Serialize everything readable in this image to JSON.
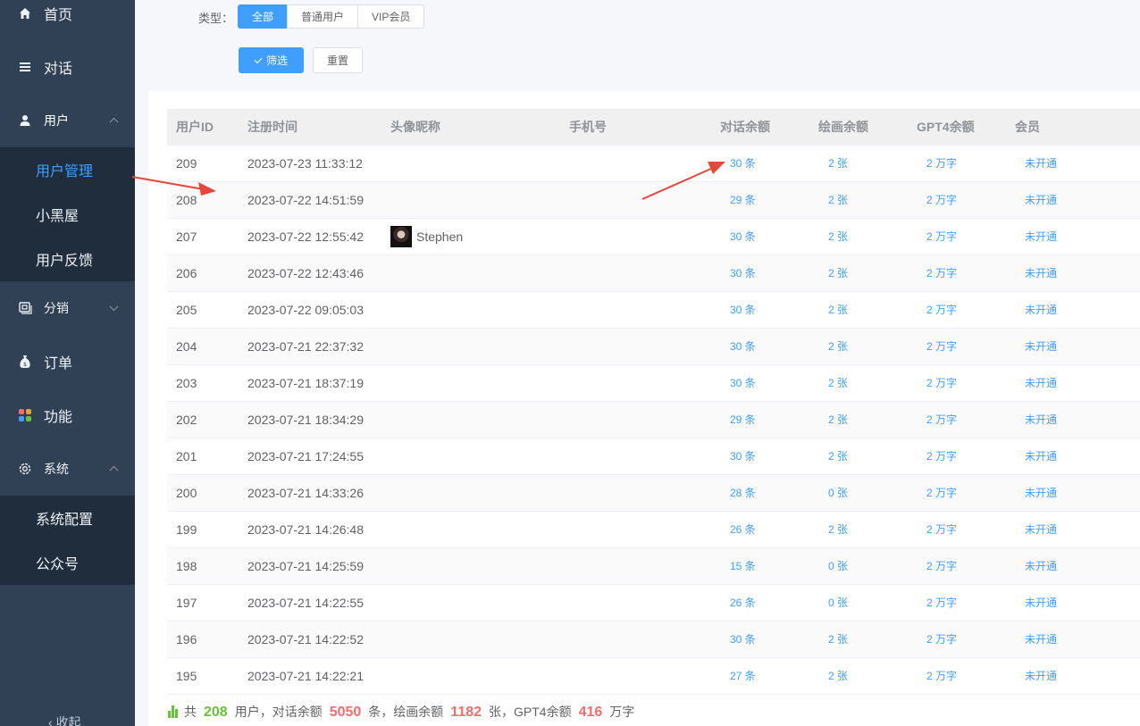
{
  "sidebar": {
    "items": [
      {
        "label": "首页",
        "icon": "home-icon"
      },
      {
        "label": "对话",
        "icon": "list-icon"
      },
      {
        "label": "用户",
        "icon": "user-icon"
      },
      {
        "label": "分销",
        "icon": "distribution-icon"
      },
      {
        "label": "订单",
        "icon": "money-bag-icon"
      },
      {
        "label": "功能",
        "icon": "apps-icon"
      },
      {
        "label": "系统",
        "icon": "gear-icon"
      }
    ],
    "user_sub": [
      "用户管理",
      "小黑屋",
      "用户反馈"
    ],
    "system_sub": [
      "系统配置",
      "公众号"
    ],
    "collapse_label": "收起"
  },
  "filter": {
    "type_label": "类型：",
    "type_options": [
      "全部",
      "普通用户",
      "VIP会员"
    ],
    "selected": "全部",
    "filter_button": "筛选",
    "reset_button": "重置"
  },
  "table": {
    "columns": [
      "用户ID",
      "注册时间",
      "头像昵称",
      "手机号",
      "对话余额",
      "绘画余额",
      "GPT4余额",
      "会员"
    ],
    "rows": [
      {
        "id": "209",
        "time": "2023-07-23 11:33:12",
        "nick": "",
        "phone": "",
        "chat": "30 条",
        "draw": "2 张",
        "gpt4": "2 万字",
        "vip": "未开通"
      },
      {
        "id": "208",
        "time": "2023-07-22 14:51:59",
        "nick": "",
        "phone": "",
        "chat": "29 条",
        "draw": "2 张",
        "gpt4": "2 万字",
        "vip": "未开通"
      },
      {
        "id": "207",
        "time": "2023-07-22 12:55:42",
        "nick": "Stephen",
        "phone": "",
        "chat": "30 条",
        "draw": "2 张",
        "gpt4": "2 万字",
        "vip": "未开通"
      },
      {
        "id": "206",
        "time": "2023-07-22 12:43:46",
        "nick": "",
        "phone": "",
        "chat": "30 条",
        "draw": "2 张",
        "gpt4": "2 万字",
        "vip": "未开通"
      },
      {
        "id": "205",
        "time": "2023-07-22 09:05:03",
        "nick": "",
        "phone": "",
        "chat": "30 条",
        "draw": "2 张",
        "gpt4": "2 万字",
        "vip": "未开通"
      },
      {
        "id": "204",
        "time": "2023-07-21 22:37:32",
        "nick": "",
        "phone": "",
        "chat": "30 条",
        "draw": "2 张",
        "gpt4": "2 万字",
        "vip": "未开通"
      },
      {
        "id": "203",
        "time": "2023-07-21 18:37:19",
        "nick": "",
        "phone": "",
        "chat": "30 条",
        "draw": "2 张",
        "gpt4": "2 万字",
        "vip": "未开通"
      },
      {
        "id": "202",
        "time": "2023-07-21 18:34:29",
        "nick": "",
        "phone": "",
        "chat": "29 条",
        "draw": "2 张",
        "gpt4": "2 万字",
        "vip": "未开通"
      },
      {
        "id": "201",
        "time": "2023-07-21 17:24:55",
        "nick": "",
        "phone": "",
        "chat": "30 条",
        "draw": "2 张",
        "gpt4": "2 万字",
        "vip": "未开通"
      },
      {
        "id": "200",
        "time": "2023-07-21 14:33:26",
        "nick": "",
        "phone": "",
        "chat": "28 条",
        "draw": "0 张",
        "gpt4": "2 万字",
        "vip": "未开通"
      },
      {
        "id": "199",
        "time": "2023-07-21 14:26:48",
        "nick": "",
        "phone": "",
        "chat": "26 条",
        "draw": "2 张",
        "gpt4": "2 万字",
        "vip": "未开通"
      },
      {
        "id": "198",
        "time": "2023-07-21 14:25:59",
        "nick": "",
        "phone": "",
        "chat": "15 条",
        "draw": "0 张",
        "gpt4": "2 万字",
        "vip": "未开通"
      },
      {
        "id": "197",
        "time": "2023-07-21 14:22:55",
        "nick": "",
        "phone": "",
        "chat": "26 条",
        "draw": "0 张",
        "gpt4": "2 万字",
        "vip": "未开通"
      },
      {
        "id": "196",
        "time": "2023-07-21 14:22:52",
        "nick": "",
        "phone": "",
        "chat": "30 条",
        "draw": "2 张",
        "gpt4": "2 万字",
        "vip": "未开通"
      },
      {
        "id": "195",
        "time": "2023-07-21 14:22:21",
        "nick": "",
        "phone": "",
        "chat": "27 条",
        "draw": "2 张",
        "gpt4": "2 万字",
        "vip": "未开通"
      }
    ]
  },
  "summary": {
    "prefix": "共",
    "users": "208",
    "users_text": "用户，对话余额",
    "chat_total": "5050",
    "chat_text": "条，绘画余额",
    "draw_total": "1182",
    "draw_text": "张，GPT4余额",
    "gpt4_total": "416",
    "gpt4_text": "万字"
  },
  "colors": {
    "accent": "#409eff",
    "sidebar": "#304156",
    "green": "#67c23a",
    "red": "#f56c6c",
    "annotation": "#e8463a"
  }
}
